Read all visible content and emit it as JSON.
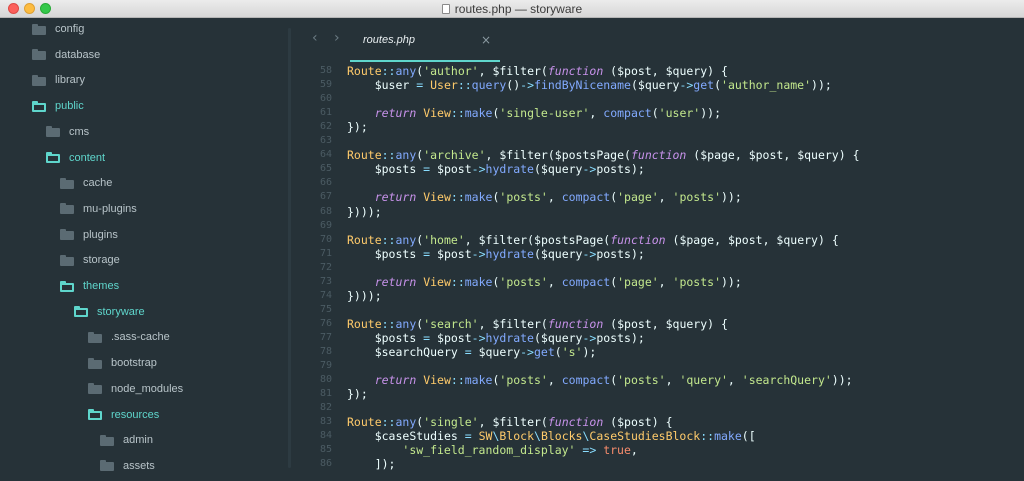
{
  "window": {
    "title": "routes.php — storyware"
  },
  "sidebar": {
    "items": [
      {
        "label": "config",
        "state": "closed"
      },
      {
        "label": "database",
        "state": "closed"
      },
      {
        "label": "library",
        "state": "closed"
      },
      {
        "label": "public",
        "state": "open"
      },
      {
        "label": "cms",
        "state": "closed"
      },
      {
        "label": "content",
        "state": "open"
      },
      {
        "label": "cache",
        "state": "closed"
      },
      {
        "label": "mu-plugins",
        "state": "closed"
      },
      {
        "label": "plugins",
        "state": "closed"
      },
      {
        "label": "storage",
        "state": "closed"
      },
      {
        "label": "themes",
        "state": "open"
      },
      {
        "label": "storyware",
        "state": "open"
      },
      {
        "label": ".sass-cache",
        "state": "closed"
      },
      {
        "label": "bootstrap",
        "state": "closed"
      },
      {
        "label": "node_modules",
        "state": "closed"
      },
      {
        "label": "resources",
        "state": "open"
      },
      {
        "label": "admin",
        "state": "closed"
      },
      {
        "label": "assets",
        "state": "closed"
      }
    ]
  },
  "editor": {
    "back_icon": "chevron-left-icon",
    "forward_icon": "chevron-right-icon",
    "tab": {
      "label": "routes.php",
      "close": "×"
    },
    "lines": [
      {
        "n": "58",
        "tokens": [
          [
            "cls",
            "Route"
          ],
          [
            "op",
            "::"
          ],
          [
            "fn",
            "any"
          ],
          [
            "p",
            "("
          ],
          [
            "str",
            "'author'"
          ],
          [
            "p",
            ", "
          ],
          [
            "var",
            "$filter"
          ],
          [
            "p",
            "("
          ],
          [
            "kw",
            "function"
          ],
          [
            "p",
            " ("
          ],
          [
            "var",
            "$post"
          ],
          [
            "p",
            ", "
          ],
          [
            "var",
            "$query"
          ],
          [
            "p",
            ") {"
          ]
        ]
      },
      {
        "n": "59",
        "tokens": [
          [
            "p",
            "    "
          ],
          [
            "var",
            "$user"
          ],
          [
            "op",
            " = "
          ],
          [
            "cls",
            "User"
          ],
          [
            "op",
            "::"
          ],
          [
            "fn",
            "query"
          ],
          [
            "p",
            "()"
          ],
          [
            "op",
            "->"
          ],
          [
            "fn",
            "findByNicename"
          ],
          [
            "p",
            "("
          ],
          [
            "var",
            "$query"
          ],
          [
            "op",
            "->"
          ],
          [
            "fn",
            "get"
          ],
          [
            "p",
            "("
          ],
          [
            "str",
            "'author_name'"
          ],
          [
            "p",
            "));"
          ]
        ]
      },
      {
        "n": "60",
        "tokens": []
      },
      {
        "n": "61",
        "tokens": [
          [
            "p",
            "    "
          ],
          [
            "kw",
            "return"
          ],
          [
            "p",
            " "
          ],
          [
            "cls",
            "View"
          ],
          [
            "op",
            "::"
          ],
          [
            "fn",
            "make"
          ],
          [
            "p",
            "("
          ],
          [
            "str",
            "'single-user'"
          ],
          [
            "p",
            ", "
          ],
          [
            "fn",
            "compact"
          ],
          [
            "p",
            "("
          ],
          [
            "str",
            "'user'"
          ],
          [
            "p",
            "));"
          ]
        ]
      },
      {
        "n": "62",
        "tokens": [
          [
            "p",
            "});"
          ]
        ]
      },
      {
        "n": "63",
        "tokens": []
      },
      {
        "n": "64",
        "tokens": [
          [
            "cls",
            "Route"
          ],
          [
            "op",
            "::"
          ],
          [
            "fn",
            "any"
          ],
          [
            "p",
            "("
          ],
          [
            "str",
            "'archive'"
          ],
          [
            "p",
            ", "
          ],
          [
            "var",
            "$filter"
          ],
          [
            "p",
            "("
          ],
          [
            "var",
            "$postsPage"
          ],
          [
            "p",
            "("
          ],
          [
            "kw",
            "function"
          ],
          [
            "p",
            " ("
          ],
          [
            "var",
            "$page"
          ],
          [
            "p",
            ", "
          ],
          [
            "var",
            "$post"
          ],
          [
            "p",
            ", "
          ],
          [
            "var",
            "$query"
          ],
          [
            "p",
            ") {"
          ]
        ]
      },
      {
        "n": "65",
        "tokens": [
          [
            "p",
            "    "
          ],
          [
            "var",
            "$posts"
          ],
          [
            "op",
            " = "
          ],
          [
            "var",
            "$post"
          ],
          [
            "op",
            "->"
          ],
          [
            "fn",
            "hydrate"
          ],
          [
            "p",
            "("
          ],
          [
            "var",
            "$query"
          ],
          [
            "op",
            "->"
          ],
          [
            "var",
            "posts"
          ],
          [
            "p",
            ");"
          ]
        ]
      },
      {
        "n": "66",
        "tokens": []
      },
      {
        "n": "67",
        "tokens": [
          [
            "p",
            "    "
          ],
          [
            "kw",
            "return"
          ],
          [
            "p",
            " "
          ],
          [
            "cls",
            "View"
          ],
          [
            "op",
            "::"
          ],
          [
            "fn",
            "make"
          ],
          [
            "p",
            "("
          ],
          [
            "str",
            "'posts'"
          ],
          [
            "p",
            ", "
          ],
          [
            "fn",
            "compact"
          ],
          [
            "p",
            "("
          ],
          [
            "str",
            "'page'"
          ],
          [
            "p",
            ", "
          ],
          [
            "str",
            "'posts'"
          ],
          [
            "p",
            "));"
          ]
        ]
      },
      {
        "n": "68",
        "tokens": [
          [
            "p",
            "})));"
          ]
        ]
      },
      {
        "n": "69",
        "tokens": []
      },
      {
        "n": "70",
        "tokens": [
          [
            "cls",
            "Route"
          ],
          [
            "op",
            "::"
          ],
          [
            "fn",
            "any"
          ],
          [
            "p",
            "("
          ],
          [
            "str",
            "'home'"
          ],
          [
            "p",
            ", "
          ],
          [
            "var",
            "$filter"
          ],
          [
            "p",
            "("
          ],
          [
            "var",
            "$postsPage"
          ],
          [
            "p",
            "("
          ],
          [
            "kw",
            "function"
          ],
          [
            "p",
            " ("
          ],
          [
            "var",
            "$page"
          ],
          [
            "p",
            ", "
          ],
          [
            "var",
            "$post"
          ],
          [
            "p",
            ", "
          ],
          [
            "var",
            "$query"
          ],
          [
            "p",
            ") {"
          ]
        ]
      },
      {
        "n": "71",
        "tokens": [
          [
            "p",
            "    "
          ],
          [
            "var",
            "$posts"
          ],
          [
            "op",
            " = "
          ],
          [
            "var",
            "$post"
          ],
          [
            "op",
            "->"
          ],
          [
            "fn",
            "hydrate"
          ],
          [
            "p",
            "("
          ],
          [
            "var",
            "$query"
          ],
          [
            "op",
            "->"
          ],
          [
            "var",
            "posts"
          ],
          [
            "p",
            ");"
          ]
        ]
      },
      {
        "n": "72",
        "tokens": []
      },
      {
        "n": "73",
        "tokens": [
          [
            "p",
            "    "
          ],
          [
            "kw",
            "return"
          ],
          [
            "p",
            " "
          ],
          [
            "cls",
            "View"
          ],
          [
            "op",
            "::"
          ],
          [
            "fn",
            "make"
          ],
          [
            "p",
            "("
          ],
          [
            "str",
            "'posts'"
          ],
          [
            "p",
            ", "
          ],
          [
            "fn",
            "compact"
          ],
          [
            "p",
            "("
          ],
          [
            "str",
            "'page'"
          ],
          [
            "p",
            ", "
          ],
          [
            "str",
            "'posts'"
          ],
          [
            "p",
            "));"
          ]
        ]
      },
      {
        "n": "74",
        "tokens": [
          [
            "p",
            "})));"
          ]
        ]
      },
      {
        "n": "75",
        "tokens": []
      },
      {
        "n": "76",
        "tokens": [
          [
            "cls",
            "Route"
          ],
          [
            "op",
            "::"
          ],
          [
            "fn",
            "any"
          ],
          [
            "p",
            "("
          ],
          [
            "str",
            "'search'"
          ],
          [
            "p",
            ", "
          ],
          [
            "var",
            "$filter"
          ],
          [
            "p",
            "("
          ],
          [
            "kw",
            "function"
          ],
          [
            "p",
            " ("
          ],
          [
            "var",
            "$post"
          ],
          [
            "p",
            ", "
          ],
          [
            "var",
            "$query"
          ],
          [
            "p",
            ") {"
          ]
        ]
      },
      {
        "n": "77",
        "tokens": [
          [
            "p",
            "    "
          ],
          [
            "var",
            "$posts"
          ],
          [
            "op",
            " = "
          ],
          [
            "var",
            "$post"
          ],
          [
            "op",
            "->"
          ],
          [
            "fn",
            "hydrate"
          ],
          [
            "p",
            "("
          ],
          [
            "var",
            "$query"
          ],
          [
            "op",
            "->"
          ],
          [
            "var",
            "posts"
          ],
          [
            "p",
            ");"
          ]
        ]
      },
      {
        "n": "78",
        "tokens": [
          [
            "p",
            "    "
          ],
          [
            "var",
            "$searchQuery"
          ],
          [
            "op",
            " = "
          ],
          [
            "var",
            "$query"
          ],
          [
            "op",
            "->"
          ],
          [
            "fn",
            "get"
          ],
          [
            "p",
            "("
          ],
          [
            "str",
            "'s'"
          ],
          [
            "p",
            ");"
          ]
        ]
      },
      {
        "n": "79",
        "tokens": []
      },
      {
        "n": "80",
        "tokens": [
          [
            "p",
            "    "
          ],
          [
            "kw",
            "return"
          ],
          [
            "p",
            " "
          ],
          [
            "cls",
            "View"
          ],
          [
            "op",
            "::"
          ],
          [
            "fn",
            "make"
          ],
          [
            "p",
            "("
          ],
          [
            "str",
            "'posts'"
          ],
          [
            "p",
            ", "
          ],
          [
            "fn",
            "compact"
          ],
          [
            "p",
            "("
          ],
          [
            "str",
            "'posts'"
          ],
          [
            "p",
            ", "
          ],
          [
            "str",
            "'query'"
          ],
          [
            "p",
            ", "
          ],
          [
            "str",
            "'searchQuery'"
          ],
          [
            "p",
            "));"
          ]
        ]
      },
      {
        "n": "81",
        "tokens": [
          [
            "p",
            "});"
          ]
        ]
      },
      {
        "n": "82",
        "tokens": []
      },
      {
        "n": "83",
        "tokens": [
          [
            "cls",
            "Route"
          ],
          [
            "op",
            "::"
          ],
          [
            "fn",
            "any"
          ],
          [
            "p",
            "("
          ],
          [
            "str",
            "'single'"
          ],
          [
            "p",
            ", "
          ],
          [
            "var",
            "$filter"
          ],
          [
            "p",
            "("
          ],
          [
            "kw",
            "function"
          ],
          [
            "p",
            " ("
          ],
          [
            "var",
            "$post"
          ],
          [
            "p",
            ") {"
          ]
        ]
      },
      {
        "n": "84",
        "tokens": [
          [
            "p",
            "    "
          ],
          [
            "var",
            "$caseStudies"
          ],
          [
            "op",
            " = "
          ],
          [
            "cls",
            "SW"
          ],
          [
            "op",
            "\\"
          ],
          [
            "cls",
            "Block"
          ],
          [
            "op",
            "\\"
          ],
          [
            "cls",
            "Blocks"
          ],
          [
            "op",
            "\\"
          ],
          [
            "cls",
            "CaseStudiesBlock"
          ],
          [
            "op",
            "::"
          ],
          [
            "fn",
            "make"
          ],
          [
            "p",
            "(["
          ]
        ]
      },
      {
        "n": "85",
        "tokens": [
          [
            "p",
            "        "
          ],
          [
            "str",
            "'sw_field_random_display'"
          ],
          [
            "op",
            " => "
          ],
          [
            "bool",
            "true"
          ],
          [
            "p",
            ","
          ]
        ]
      },
      {
        "n": "86",
        "tokens": [
          [
            "p",
            "    "
          ],
          [
            "p",
            "]);"
          ]
        ]
      }
    ]
  }
}
